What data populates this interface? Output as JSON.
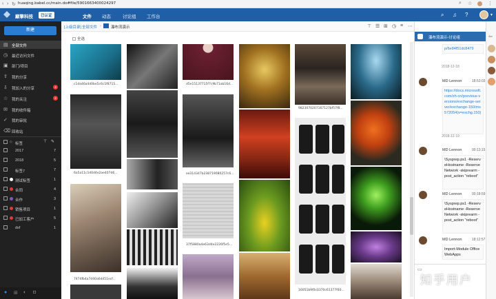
{
  "browser": {
    "url": "huaqing.babel.cc/main.do#file/5901663400024297"
  },
  "app": {
    "brand": "巅擎科技",
    "badge": "已认证",
    "tabs": [
      {
        "label": "文件",
        "active": true
      },
      {
        "label": "动态",
        "active": false
      },
      {
        "label": "讨论组",
        "active": false
      },
      {
        "label": "工作台",
        "active": false
      }
    ],
    "colors": {
      "header": "#1f5fa8",
      "sidebar": "#212121",
      "accent": "#2b7cd3",
      "alert": "#e53935"
    }
  },
  "sidebar": {
    "new_button": "新建",
    "items": [
      {
        "label": "全部文件",
        "icon": "folder-icon",
        "active": true
      },
      {
        "label": "最近访问文件",
        "icon": "clock-icon"
      },
      {
        "label": "部门/项目",
        "icon": "org-icon"
      },
      {
        "label": "我的分享",
        "icon": "share-icon"
      },
      {
        "label": "我加入的分享",
        "icon": "share-in-icon",
        "count": "4"
      },
      {
        "label": "我的关注",
        "icon": "star-icon",
        "count": "2"
      },
      {
        "label": "我的收件箱",
        "icon": "inbox-icon"
      },
      {
        "label": "我的审批",
        "icon": "approve-icon"
      },
      {
        "label": "回收站",
        "icon": "trash-icon"
      }
    ],
    "tags_header": "标签",
    "tags": [
      {
        "label": "2017",
        "count": "7",
        "color": ""
      },
      {
        "label": "2018",
        "count": "5",
        "color": ""
      },
      {
        "label": "标签7",
        "count": "7",
        "color": ""
      },
      {
        "label": "测试标签",
        "count": "1",
        "color": "#ffffff"
      },
      {
        "label": "合同",
        "count": "4",
        "color": "#e53935"
      },
      {
        "label": "合作",
        "count": "3",
        "color": "#7e57c2"
      },
      {
        "label": "销售项目",
        "count": "1",
        "color": "#e53935"
      },
      {
        "label": "已加工客户",
        "count": "5",
        "color": "#e53935"
      },
      {
        "label": "dsf",
        "count": "1",
        "color": ""
      }
    ]
  },
  "main": {
    "breadcrumb": [
      "[上级目录]",
      "全部文件",
      "瀑布流演示"
    ],
    "select_all": "全选",
    "captions": {
      "col1_a": "c1da46a4d0be5c6c1f8715...",
      "col1_b": "6a5a11c1d0d4e2ae407d6...",
      "col1_c": "7474fb4a7d40a6d451ecf...",
      "col3_a": "d5e15137715f7c9b71ab16d...",
      "col3_b": "ee314347b238719080257c6...",
      "col3_c": "37f5880a4e63d4e2226f5e5...",
      "col5_a": "9823070207167127bf57f8...",
      "col5_b": "16051b9f0c0370c61377f40..."
    }
  },
  "chat": {
    "title": "瀑布流演示-讨论组",
    "top_link": "p/6e84f51dc8479",
    "messages": [
      {
        "date": "2018-12-18",
        "name": "MD Lennon",
        "time": "18:53:03",
        "text": "https://docs.microsoft.com/zh-cn/previous-versions/exchange-server/exchange-150/ms572054(v=exchg.150)",
        "link": true
      },
      {
        "date": "2018-12-19",
        "name": "MD Lennon",
        "time": "00:13:15",
        "text": "\\Sysprep.ps1 -ReserveHostname -ReserveNetwork -skiprearm -post_action \"reboot\""
      },
      {
        "name": "MD Lennon",
        "time": "00:18:59",
        "text": "\\Sysprep.ps1 -ReserveHostname -ReserveNetwork -skiprearm -post_action \"reboot\""
      },
      {
        "name": "MD Lennon",
        "time": "18:12:57",
        "text": "Import-Module OfficeWebApps"
      }
    ]
  },
  "watermark": "知乎用户"
}
